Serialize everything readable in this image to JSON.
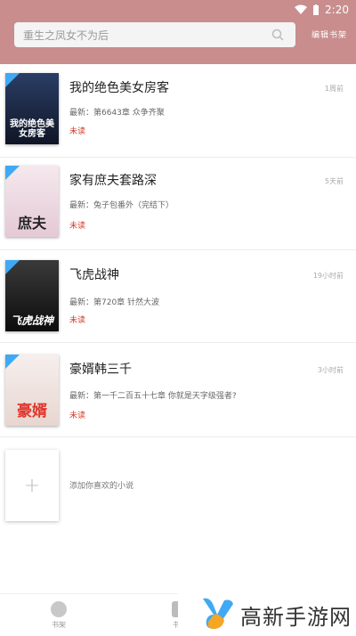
{
  "status_bar": {
    "time": "2:20"
  },
  "search": {
    "placeholder": "重生之凤女不为后"
  },
  "header": {
    "edit_label": "编辑书架"
  },
  "books": [
    {
      "title": "我的绝色美女房客",
      "time": "1周前",
      "latest": "最新：第6643章 众争齐聚",
      "status": "未读",
      "cover_text": "我的绝色美女房客",
      "cover_color": "#1c2a44"
    },
    {
      "title": "家有庶夫套路深",
      "time": "5天前",
      "latest": "最新：兔子包番外（完结下）",
      "status": "未读",
      "cover_text": "庶夫",
      "cover_color": "#eedfe6"
    },
    {
      "title": "飞虎战神",
      "time": "19小时前",
      "latest": "最新：第720章 针然大波",
      "status": "未读",
      "cover_text": "飞虎战神",
      "cover_color": "#1a1a1a"
    },
    {
      "title": "豪婿韩三千",
      "time": "3小时前",
      "latest": "最新：第一千二百五十七章 你就是天字级强者?",
      "status": "未读",
      "cover_text": "豪婿",
      "cover_color": "#f3ecea"
    }
  ],
  "add_book": {
    "label": "添加你喜欢的小说"
  },
  "bottom_nav": [
    {
      "label": "书架"
    },
    {
      "label": "书城"
    }
  ],
  "watermark": {
    "text": "高新手游网"
  },
  "colors": {
    "header": "#c98d8d",
    "status_red": "#d23a2a",
    "badge_blue": "#3fa9f5"
  }
}
